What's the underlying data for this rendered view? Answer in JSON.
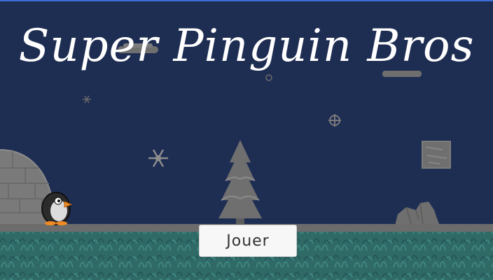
{
  "game": {
    "title": "Super Pinguin Bros",
    "play_label": "Jouer"
  },
  "colors": {
    "sky": "#1e2d52",
    "ground": "#2f6a66",
    "ground_edge": "#6c6c6c",
    "scenery": "#6f6f6f",
    "penguin_body": "#2b2b2b",
    "beak": "#f08a24"
  },
  "icons": [
    "snowflake-icon",
    "igloo",
    "pine-tree",
    "rock-pile",
    "ice-block",
    "cloud-platform",
    "penguin-character"
  ]
}
